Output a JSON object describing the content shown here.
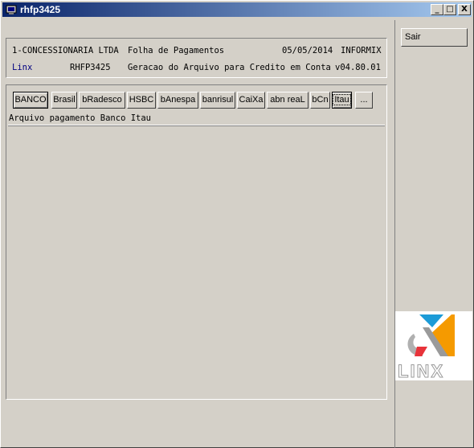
{
  "window": {
    "title": "rhfp3425",
    "controls": {
      "minimize": "_",
      "maximize": "□",
      "close": "X"
    }
  },
  "header": {
    "company": "1-CONCESSIONARIA LTDA",
    "module": "Folha de Pagamentos",
    "date": "05/05/2014",
    "database": "INFORMIX",
    "brand": "Linx",
    "program": "RHFP3425",
    "description": "Geracao do Arquivo para Credito em Conta",
    "version": "v04.80.01"
  },
  "tabs": [
    "BANCO",
    "Brasil",
    "bRadesco",
    "HSBC",
    "bAnespa",
    "banrisul",
    "CaiXa",
    "abn reaL",
    "bCn",
    "Itau",
    "..."
  ],
  "active_tab_index": 9,
  "content": {
    "description": "Arquivo pagamento Banco Itau"
  },
  "actions": {
    "sair_label": "Sair"
  },
  "logo": {
    "text": "LINX",
    "colors": {
      "blue": "#1c9bd7",
      "red": "#e8333a",
      "orange": "#f59a00",
      "gray": "#9a9a9a"
    }
  },
  "colors": {
    "titlebar_start": "#0a246a",
    "titlebar_end": "#a6caf0",
    "face": "#d4d0c8",
    "brand_text": "#000080"
  }
}
